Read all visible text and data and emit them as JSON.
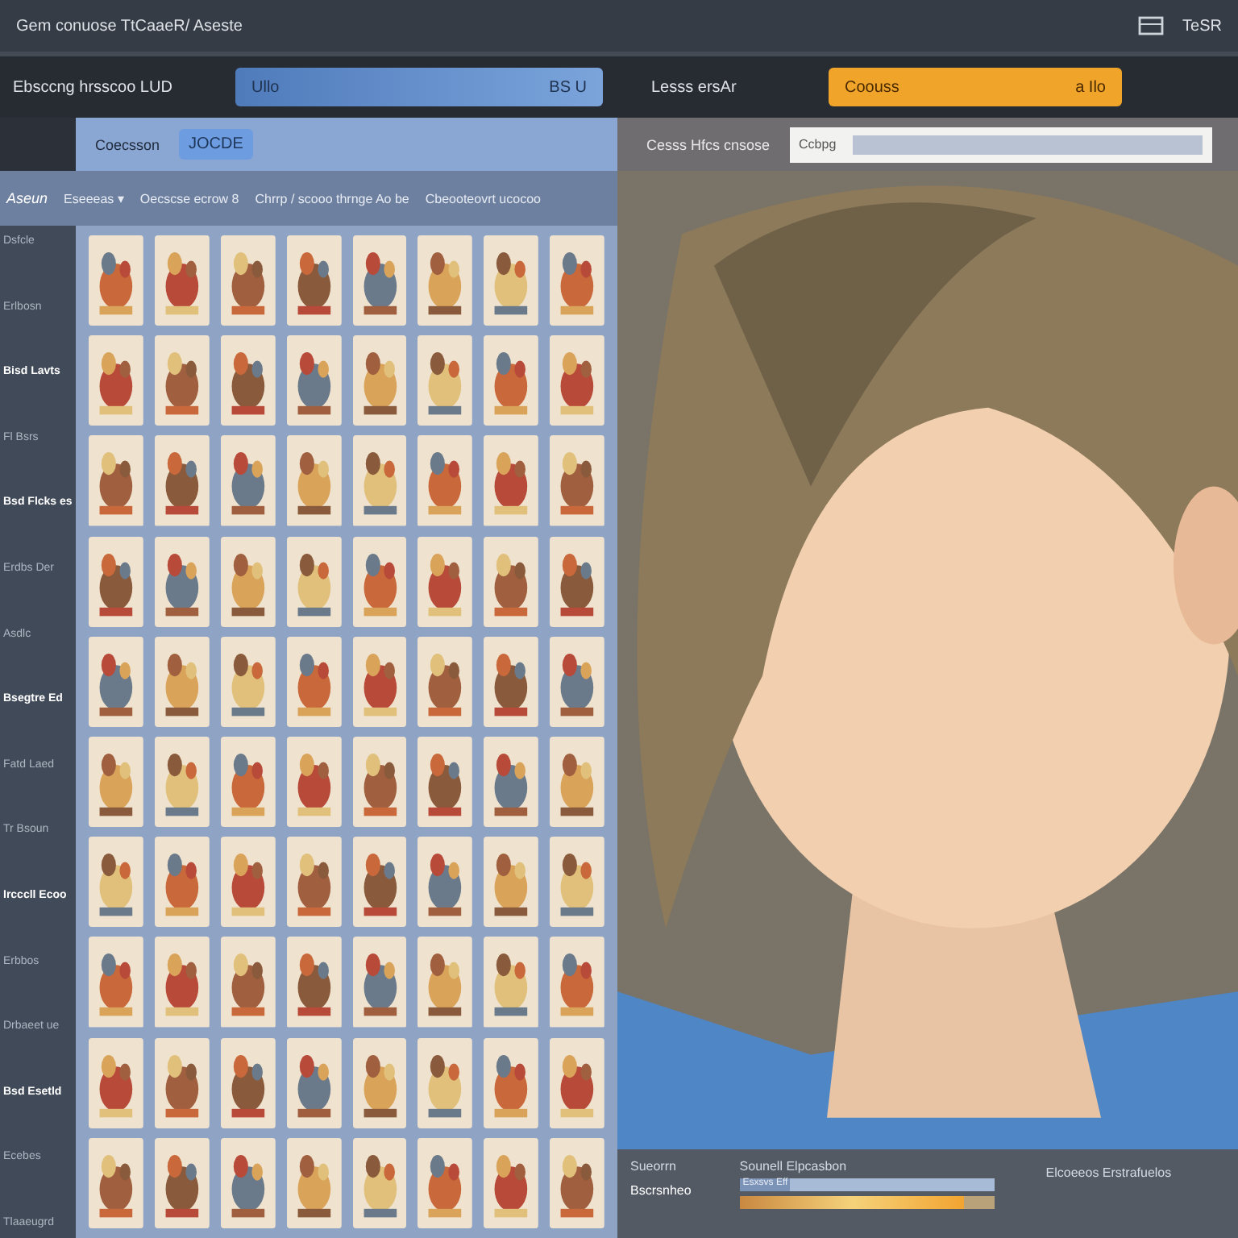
{
  "title_bar": {
    "title": "Gem conuose TtCaaeR/ Aseste",
    "right_label": "TeSR"
  },
  "filter_row": {
    "label_1": "Ebsccng hrsscoo LUD",
    "field_1": {
      "value": "Ullo",
      "suffix": "BS U"
    },
    "label_2": "Lesss ersAr",
    "field_2": {
      "value": "Coouss",
      "suffix": "a Ilo"
    }
  },
  "options_row": {
    "label_1": "Coecsson",
    "button": "JOCDE",
    "label_2": "Cesss Hfcs cnsose",
    "field": {
      "value": "Ccbpg"
    }
  },
  "sidebar": {
    "header": "Aseun",
    "items": [
      {
        "label": "Dsfcle",
        "kind": "item"
      },
      {
        "label": "Erlbosn",
        "kind": "item"
      },
      {
        "label": "Bisd Lavts",
        "kind": "heading"
      },
      {
        "label": "Fl Bsrs",
        "kind": "item"
      },
      {
        "label": "Bsd Flcks es",
        "kind": "heading"
      },
      {
        "label": "Erdbs Der",
        "kind": "item"
      },
      {
        "label": "Asdlc",
        "kind": "item"
      },
      {
        "label": "Bsegtre Ed",
        "kind": "heading"
      },
      {
        "label": "Fatd Laed",
        "kind": "item"
      },
      {
        "label": "Tr Bsoun",
        "kind": "item"
      },
      {
        "label": "Ircccll Ecoo",
        "kind": "heading"
      },
      {
        "label": "Erbbos",
        "kind": "item"
      },
      {
        "label": "Drbaeet ue",
        "kind": "item"
      },
      {
        "label": "Bsd Esetld",
        "kind": "heading"
      },
      {
        "label": "Ecebes",
        "kind": "item"
      },
      {
        "label": "Tlaaeugrd",
        "kind": "item"
      }
    ]
  },
  "columns": [
    "Eseeeas ▾",
    "Oecscse ecrow 8",
    "Chrrp / scooo thrnge Ao be",
    "Cbeooteovrt ucocoo"
  ],
  "status_bar": {
    "label_1": "Sueorrn",
    "label_2": "Bscrsnheo",
    "label_3": "Sounell Elpcasbon",
    "label_4": "Elcoeeos Erstrafuelos",
    "meters": [
      {
        "label": "Esxsvs Eff",
        "level": 0.2
      },
      {
        "level": 0.88
      }
    ]
  }
}
